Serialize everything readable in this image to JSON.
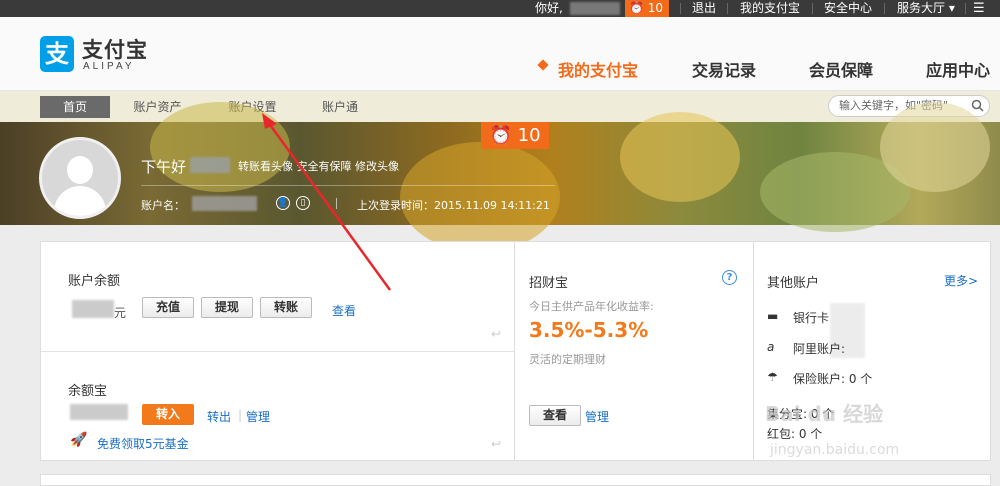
{
  "topbar": {
    "greeting": "你好,",
    "alarm_count": "10",
    "logout": "退出",
    "my_alipay": "我的支付宝",
    "security": "安全中心",
    "service": "服务大厅"
  },
  "logo": {
    "cn": "支付宝",
    "en": "ALIPAY",
    "mark": "支"
  },
  "main_nav": [
    "我的支付宝",
    "交易记录",
    "会员保障",
    "应用中心"
  ],
  "sub_nav": [
    "首页",
    "账户资产",
    "账户设置",
    "账户通"
  ],
  "search": {
    "placeholder": "输入关键字，如\"密码\""
  },
  "banner": {
    "alarm_count": "10",
    "greeting": "下午好",
    "change_avatar": "转账看头像  安全有保障 修改头像",
    "account_label": "账户名：",
    "last_login": "上次登录时间：2015.11.09 14:11:21"
  },
  "balance": {
    "title": "账户余额",
    "unit": "元",
    "recharge": "充值",
    "withdraw": "提现",
    "transfer": "转账",
    "view": "查看"
  },
  "yuebao": {
    "title": "余额宝",
    "in": "转入",
    "out": "转出",
    "manage": "管理",
    "promo": "免费领取5元基金"
  },
  "zhaocaibao": {
    "title": "招财宝",
    "desc": "今日主供产品年化收益率:",
    "rate": "3.5%-5.3%",
    "sub": "灵活的定期理财",
    "view": "查看",
    "manage": "管理",
    "help": "?"
  },
  "other": {
    "title": "其他账户",
    "more": "更多>",
    "items": [
      "银行卡",
      "阿里账户:",
      "保险账户: 0 个",
      "集分宝: 0 个",
      "红包: 0 个"
    ]
  },
  "watermark": {
    "text": "Bai du 经验",
    "url": "jingyan.baidu.com"
  },
  "colors": {
    "accent": "#f26b1b",
    "link": "#1a6ec4",
    "brand": "#009fe8"
  }
}
